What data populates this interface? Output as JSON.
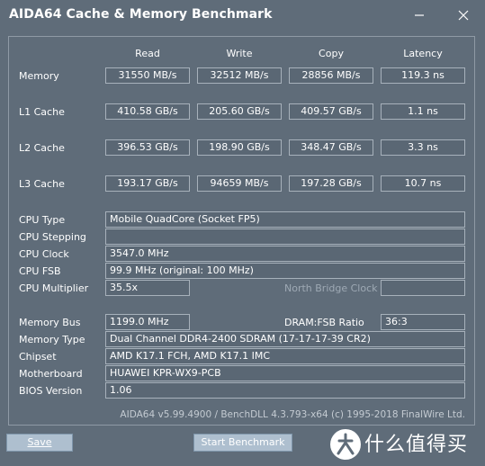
{
  "window": {
    "title": "AIDA64 Cache & Memory Benchmark",
    "controls": [
      "minimize-icon",
      "close-icon"
    ]
  },
  "columns": [
    "Read",
    "Write",
    "Copy",
    "Latency"
  ],
  "bench_rows": [
    {
      "label": "Memory",
      "read": "31550 MB/s",
      "write": "32512 MB/s",
      "copy": "28856 MB/s",
      "latency": "119.3 ns"
    },
    {
      "label": "L1 Cache",
      "read": "410.58 GB/s",
      "write": "205.60 GB/s",
      "copy": "409.57 GB/s",
      "latency": "1.1 ns"
    },
    {
      "label": "L2 Cache",
      "read": "396.53 GB/s",
      "write": "198.90 GB/s",
      "copy": "348.47 GB/s",
      "latency": "3.3 ns"
    },
    {
      "label": "L3 Cache",
      "read": "193.17 GB/s",
      "write": "94659 MB/s",
      "copy": "197.28 GB/s",
      "latency": "10.7 ns"
    }
  ],
  "cpu": {
    "type_label": "CPU Type",
    "type_value": "Mobile QuadCore  (Socket FP5)",
    "stepping_label": "CPU Stepping",
    "stepping_value": "",
    "clock_label": "CPU Clock",
    "clock_value": "3547.0 MHz",
    "fsb_label": "CPU FSB",
    "fsb_value": "99.9 MHz  (original: 100 MHz)",
    "multiplier_label": "CPU Multiplier",
    "multiplier_value": "35.5x",
    "nb_clock_label": "North Bridge Clock",
    "nb_clock_value": ""
  },
  "memory": {
    "bus_label": "Memory Bus",
    "bus_value": "1199.0 MHz",
    "ratio_label": "DRAM:FSB Ratio",
    "ratio_value": "36:3",
    "type_label": "Memory Type",
    "type_value": "Dual Channel DDR4-2400 SDRAM  (17-17-17-39 CR2)",
    "chipset_label": "Chipset",
    "chipset_value": "AMD K17.1 FCH, AMD K17.1 IMC",
    "motherboard_label": "Motherboard",
    "motherboard_value": "HUAWEI KPR-WX9-PCB",
    "bios_label": "BIOS Version",
    "bios_value": "1.06"
  },
  "footer": "AIDA64 v5.99.4900 / BenchDLL 4.3.793-x64  (c) 1995-2018 FinalWire Ltd.",
  "buttons": {
    "save": "Save",
    "start": "Start Benchmark"
  },
  "watermark": {
    "text": "什么值得买"
  },
  "colors": {
    "background": "#5f6c79",
    "button": "#aebfcf",
    "border": "#a7b1bb"
  }
}
